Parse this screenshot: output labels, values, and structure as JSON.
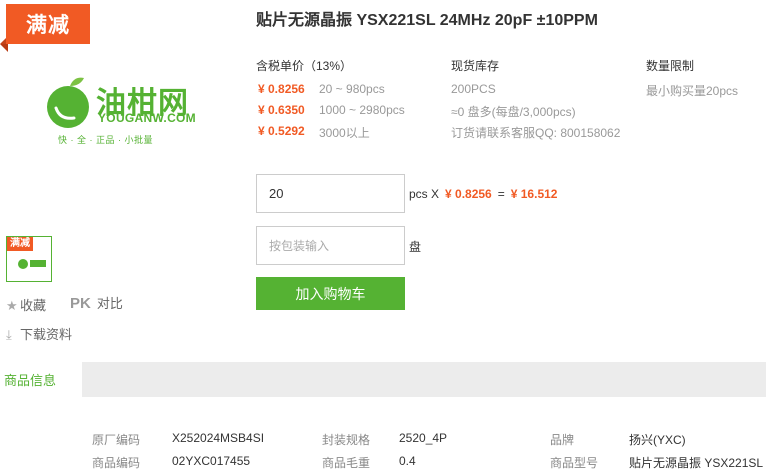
{
  "promo_badge": "满减",
  "logo": {
    "name": "油柑网",
    "url": "YOUGANW.COM",
    "slogan": "快 · 全 · 正品 · 小批量"
  },
  "thumbnail": {
    "badge": "满减"
  },
  "side_actions": {
    "favorite": "收藏",
    "compare_pk": "PK",
    "compare": "对比",
    "download": "下载资料"
  },
  "product": {
    "title": "贴片无源晶振 YSX221SL 24MHz 20pF ±10PPM"
  },
  "pricing": {
    "header": "含税单价（13%）",
    "tiers": [
      {
        "price": "¥ 0.8256",
        "range": "20 ~ 980pcs"
      },
      {
        "price": "¥ 0.6350",
        "range": "1000 ~ 2980pcs"
      },
      {
        "price": "¥ 0.5292",
        "range": "3000以上"
      }
    ]
  },
  "stock": {
    "header": "现货库存",
    "lines": [
      "200PCS",
      "≈0 盘多(每盘/3,000pcs)",
      "订货请联系客服QQ: 800158062"
    ]
  },
  "limit": {
    "header": "数量限制",
    "text": "最小购买量20pcs"
  },
  "order": {
    "quantity_value": "20",
    "unit_x": "pcs X",
    "unit_price": "¥ 0.8256",
    "equals": "=",
    "total": "¥ 16.512",
    "reel_placeholder": "按包装输入",
    "reel_unit": "盘",
    "add_to_cart": "加入购物车"
  },
  "tabs": {
    "active": "商品信息"
  },
  "specs": [
    {
      "k1": "原厂编码",
      "v1": "X252024MSB4SI",
      "k2": "封装规格",
      "v2": "2520_4P",
      "k3": "品牌",
      "v3": "扬兴(YXC)"
    },
    {
      "k1": "商品编码",
      "v1": "02YXC017455",
      "k2": "商品毛重",
      "v2": "0.4",
      "k3": "商品型号",
      "v3": "贴片无源晶振 YSX221SL"
    }
  ],
  "colors": {
    "accent_green": "#55b233",
    "price_orange": "#f15a24",
    "tab_bg": "#ececec"
  }
}
